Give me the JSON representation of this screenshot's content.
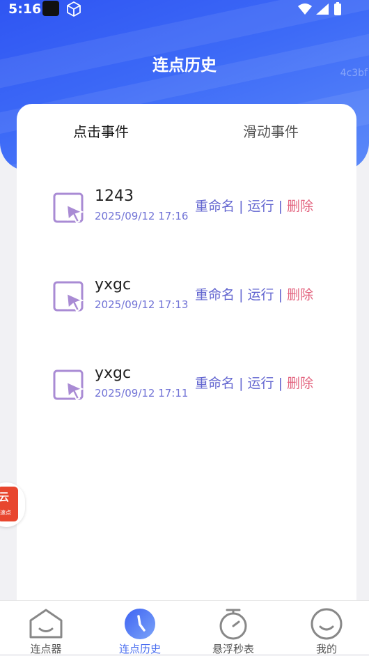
{
  "status_bar": {
    "time": "5:16"
  },
  "header": {
    "title": "连点历史",
    "watermark": "4c3bf"
  },
  "tabs": [
    {
      "label": "点击事件",
      "active": true
    },
    {
      "label": "滑动事件",
      "active": false
    }
  ],
  "records": [
    {
      "name": "1243",
      "time": "2025/09/12 17:16",
      "rename": "重命名",
      "run": "运行",
      "delete": "删除"
    },
    {
      "name": "yxgc",
      "time": "2025/09/12 17:13",
      "rename": "重命名",
      "run": "运行",
      "delete": "删除"
    },
    {
      "name": "yxgc",
      "time": "2025/09/12 17:11",
      "rename": "重命名",
      "run": "运行",
      "delete": "删除"
    }
  ],
  "separator": "|",
  "float_ad": {
    "title": "云",
    "subtitle": "速点"
  },
  "bottom_nav": [
    {
      "label": "连点器",
      "icon": "robot-face-icon",
      "active": false
    },
    {
      "label": "连点历史",
      "icon": "clock-icon",
      "active": true
    },
    {
      "label": "悬浮秒表",
      "icon": "stopwatch-icon",
      "active": false
    },
    {
      "label": "我的",
      "icon": "smile-face-icon",
      "active": false
    }
  ],
  "colors": {
    "accent": "#4a6ef0",
    "header_blue": "#3d6af7",
    "action_purple": "#6366d0",
    "delete_red": "#e3647f",
    "icon_purple": "#a98bd4"
  }
}
